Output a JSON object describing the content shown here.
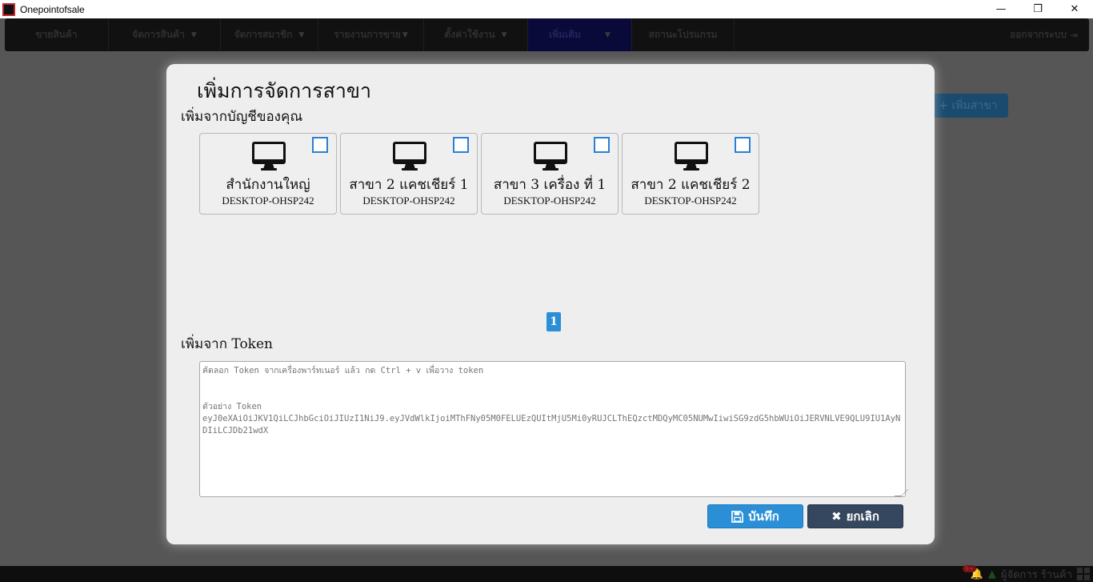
{
  "window": {
    "title": "Onepointofsale",
    "minimize": "—",
    "restore": "❐",
    "close": "✕"
  },
  "nav": {
    "items": [
      {
        "label": "ขายสินค้า",
        "has_caret": false
      },
      {
        "label": "จัดการสินค้า",
        "has_caret": true
      },
      {
        "label": "จัดการสมาชิก",
        "has_caret": true
      },
      {
        "label": "รายงานการขาย",
        "has_caret": true
      },
      {
        "label": "ตั้งค่าใช้งาน",
        "has_caret": true
      },
      {
        "label": "เพิ่มเติม",
        "has_caret": true,
        "active": true
      },
      {
        "label": "สถานะโปรแกรม",
        "has_caret": false
      }
    ],
    "logout_label": "ออกจากระบบ"
  },
  "background": {
    "add_branch_label": "+ เพิ่มสาขา"
  },
  "modal": {
    "title": "เพิ่มการจัดการสาขา",
    "from_account_label": "เพิ่มจากบัญชีของคุณ",
    "devices": [
      {
        "name": "สำนักงานใหญ่",
        "host": "DESKTOP-OHSP242",
        "checked": false
      },
      {
        "name": "สาขา 2 แคชเชียร์ 1",
        "host": "DESKTOP-OHSP242",
        "checked": false
      },
      {
        "name": "สาขา 3 เครื่อง ที่ 1",
        "host": "DESKTOP-OHSP242",
        "checked": false
      },
      {
        "name": "สาขา 2 แคชเชียร์ 2",
        "host": "DESKTOP-OHSP242",
        "checked": false
      }
    ],
    "page": "1",
    "from_token_label": "เพิ่มจาก Token",
    "token_placeholder": "คัดลอก Token จากเครื่องพาร์ทเนอร์ แล้ว กด Ctrl + v เพื่อวาง token\n\n\nตัวอย่าง Token\neyJ0eXAiOiJKV1QiLCJhbGciOiJIUzI1NiJ9.eyJVdWlkIjoiMThFNy05M0FELUEzQUItMjU5Mi0yRUJCLThEQzctMDQyMC05NUMwIiwiSG9zdG5hbWUiOiJERVNLVE9QLU9IU1AyNDIiLCJDb21wdX",
    "save_label": "บันทึก",
    "cancel_label": "ยกเลิก"
  },
  "status": {
    "notif_count": "9+",
    "user_label": "ผู้จัดการ ร้านค้า"
  }
}
